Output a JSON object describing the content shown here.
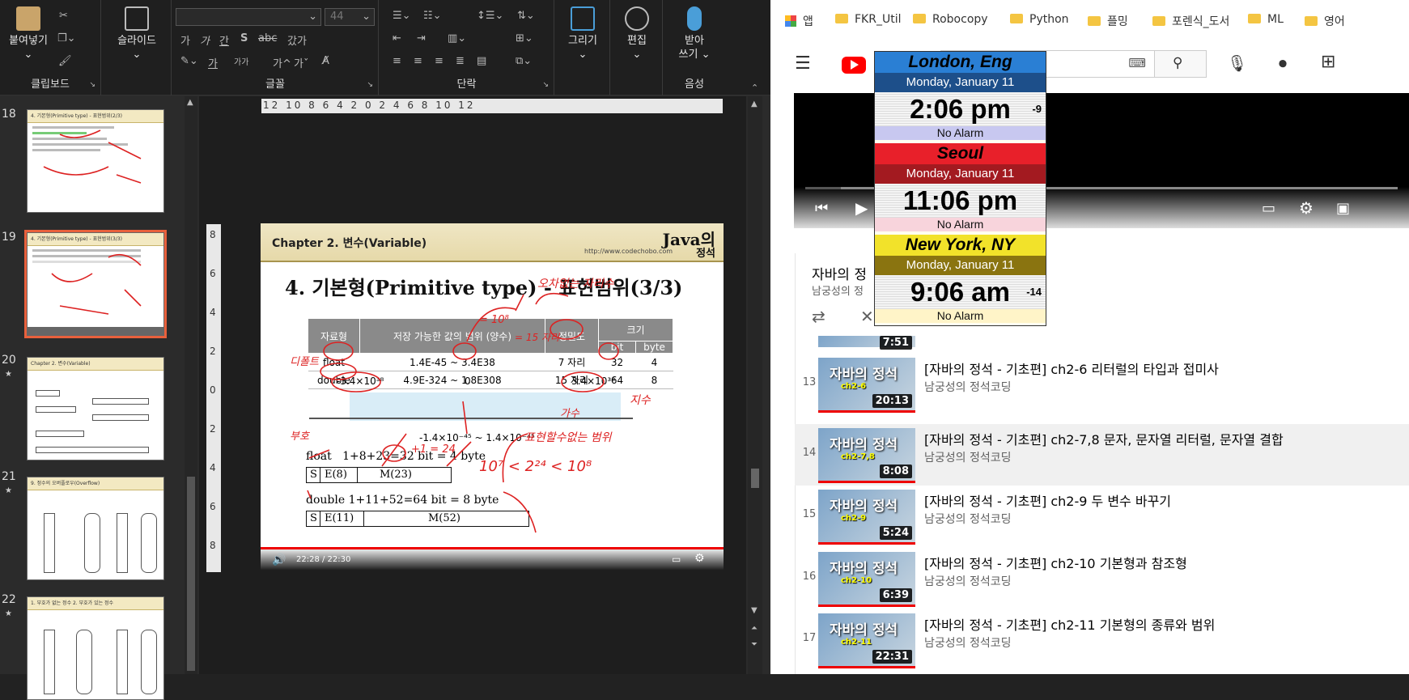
{
  "ppt": {
    "ribbon": {
      "clipboard": {
        "paste_label": "붙여넣기",
        "group_label": "클립보드"
      },
      "slides": {
        "slide_label": "슬라이드"
      },
      "font": {
        "group_label": "글꼴",
        "size_value": "44",
        "bold": "가",
        "italic": "가",
        "underline": "간",
        "strike": "S",
        "spacing": "abc",
        "case": "갔가",
        "grow": "가^",
        "shrink": "가ˇ",
        "fontcolor": "가",
        "textsize": "가가"
      },
      "paragraph": {
        "group_label": "단락"
      },
      "drawing": {
        "draw_label": "그리기"
      },
      "editing": {
        "edit_label": "편집"
      },
      "voice": {
        "dictate_label_1": "받아",
        "dictate_label_2": "쓰기",
        "group_label": "음성"
      }
    },
    "thumbnails": [
      {
        "number": "18",
        "starred": false,
        "title": "4. 기본형(Primitive type) - 표현범위(2/3)"
      },
      {
        "number": "19",
        "starred": false,
        "title": "4. 기본형(Primitive type) - 표현범위(3/3)",
        "selected": true
      },
      {
        "number": "20",
        "starred": true,
        "title": "Chapter 2. 변수(Variable)"
      },
      {
        "number": "21",
        "starred": true,
        "title": "9. 정수의 오버플로우(Overflow)"
      },
      {
        "number": "22",
        "starred": true,
        "title": "1. 부호가 없는 정수   2. 부호가 있는 정수"
      }
    ],
    "ruler_h": "12 10 8 6 4 2 0 2 4 6 8 10 12",
    "ruler_v": [
      "8",
      "6",
      "4",
      "2",
      "0",
      "2",
      "4",
      "6",
      "8"
    ],
    "slide": {
      "chapter": "Chapter 2. 변수(Variable)",
      "brand_1": "Java의",
      "brand_2": "정석",
      "url": "http://www.codechobo.com",
      "title": "4. 기본형(Primitive type) - 표현범위(3/3)",
      "table": {
        "headers": [
          "자료형",
          "저장 가능한 값의 범위 (양수)",
          "정밀도"
        ],
        "subheader": "크기",
        "subheaders": [
          "bit",
          "byte"
        ],
        "rows": [
          {
            "type": "float",
            "range": "1.4E-45 ~ 3.4E38",
            "precision": "7 자리",
            "bit": "32",
            "byte": "4"
          },
          {
            "type": "double",
            "range": "4.9E-324 ~ 1.8E308",
            "precision": "15 자리",
            "bit": "64",
            "byte": "8"
          }
        ]
      },
      "axis": {
        "neg": "-3.4×10³⁸",
        "zero": "0",
        "pos": "3.4×10³⁸",
        "gap": "-1.4×10⁻⁴⁵ ~ 1.4×10⁻⁴⁵"
      },
      "float_line": "float   1+8+23=32 bit = 4 byte",
      "double_line": "double 1+11+52=64 bit = 8 byte",
      "float_bits": [
        "S",
        "E(8)",
        "M(23)"
      ],
      "double_bits": [
        "S",
        "E(11)",
        "M(52)"
      ],
      "annotations": {
        "ann1": "오차없는 자리수",
        "ann2": "표현할수없는 범위",
        "ann3": "가수",
        "ann4": "지수",
        "ann5": "부호",
        "ann6": "10⁷ < 2²⁴ < 10⁸",
        "ann7": "디폴트",
        "ann8": "= 15 자리",
        "ann9": "+1 = 24",
        "ann10": "= 10⁸"
      },
      "player_time": "22:28 / 22:30"
    }
  },
  "browser": {
    "bookmarks": [
      {
        "label": "앱",
        "type": "apps"
      },
      {
        "label": "FKR_Util",
        "type": "folder"
      },
      {
        "label": "Robocopy",
        "type": "folder"
      },
      {
        "label": "Python",
        "type": "folder"
      },
      {
        "label": "플밍",
        "type": "folder"
      },
      {
        "label": "포렌식_도서",
        "type": "folder"
      },
      {
        "label": "ML",
        "type": "folder"
      },
      {
        "label": "영어",
        "type": "folder"
      }
    ],
    "playlist": {
      "title_partial": "자바의 정",
      "channel_partial": "남궁성의 정",
      "partial_row_duration": "7:51",
      "items": [
        {
          "index": "13",
          "title": "[자바의 정석 - 기초편] ch2-6 리터럴의 타입과 접미사",
          "channel": "남궁성의 정석코딩",
          "duration": "20:13",
          "thumb_title": "자바의 정석",
          "thumb_sub": "ch2-6"
        },
        {
          "index": "14",
          "title": "[자바의 정석 - 기초편] ch2-7,8 문자, 문자열 리터럴, 문자열 결합",
          "channel": "남궁성의 정석코딩",
          "duration": "8:08",
          "thumb_title": "자바의 정석",
          "thumb_sub": "ch2-7,8",
          "highlight": true
        },
        {
          "index": "15",
          "title": "[자바의 정석 - 기초편] ch2-9 두 변수 바꾸기",
          "channel": "남궁성의 정석코딩",
          "duration": "5:24",
          "thumb_title": "자바의 정석",
          "thumb_sub": "ch2-9"
        },
        {
          "index": "16",
          "title": "[자바의 정석 - 기초편] ch2-10 기본형과 참조형",
          "channel": "남궁성의 정석코딩",
          "duration": "6:39",
          "thumb_title": "자바의 정석",
          "thumb_sub": "ch2-10"
        },
        {
          "index": "17",
          "title": "[자바의 정석 - 기초편] ch2-11 기본형의 종류와 범위",
          "channel": "남궁성의 정석코딩",
          "duration": "22:31",
          "thumb_title": "자바의 정석",
          "thumb_sub": "ch2-11"
        }
      ]
    }
  },
  "clock": [
    {
      "city": "London, Eng",
      "date": "Monday, January 11",
      "time": "2:06 pm",
      "offset": "-9",
      "alarm": "No Alarm",
      "city_bg": "#2a7fd4",
      "date_bg": "#1d4f8a",
      "alarm_bg": "#c8c8f0"
    },
    {
      "city": "Seoul",
      "date": "Monday, January 11",
      "time": "11:06 pm",
      "offset": "",
      "alarm": "No Alarm",
      "city_bg": "#e8202a",
      "date_bg": "#a31a20",
      "alarm_bg": "#f8d4dc"
    },
    {
      "city": "New York, NY",
      "date": "Monday, January 11",
      "time": "9:06 am",
      "offset": "-14",
      "alarm": "No Alarm",
      "city_bg": "#f2e22a",
      "date_bg": "#8a7410",
      "alarm_bg": "#fff4c8"
    }
  ],
  "colors": {
    "accent_selected": "#e8603c",
    "youtube_red": "#ff0000",
    "slide_red": "#d22222"
  }
}
